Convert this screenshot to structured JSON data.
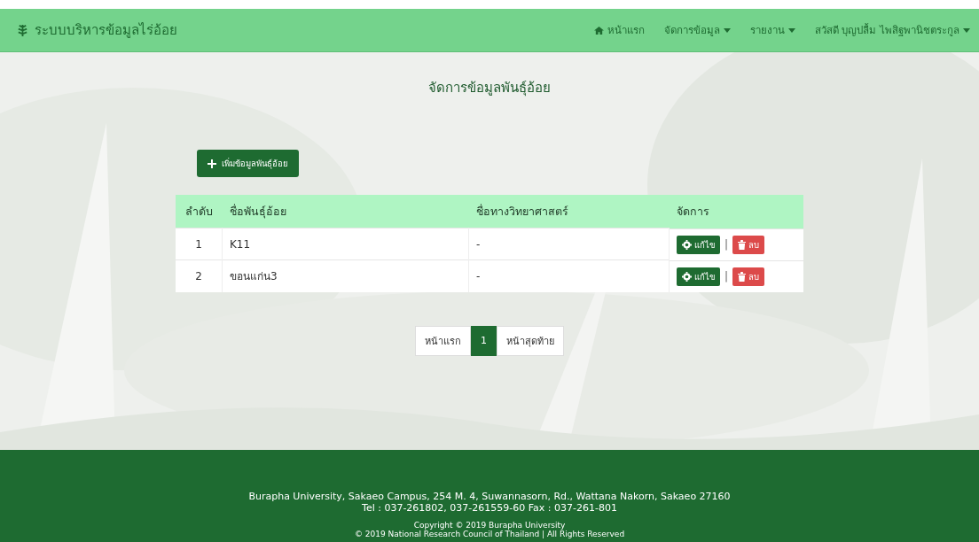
{
  "navbar": {
    "brand": "ระบบบริหารข้อมูลไร่อ้อย",
    "items": [
      {
        "label": "หน้าแรก",
        "kind": "home"
      },
      {
        "label": "จัดการข้อมูล",
        "kind": "dropdown"
      },
      {
        "label": "รายงาน",
        "kind": "dropdown"
      },
      {
        "label": "สวัสดี บุญปลื้ม ไพสิฐพานิชตระกูล",
        "kind": "dropdown"
      }
    ]
  },
  "page_title": "จัดการข้อมูลพันธุ์อ้อย",
  "add_button": "เพิ่มข้อมูลพันธุ์อ้อย",
  "table": {
    "columns": [
      "ลำดับ",
      "ชื่อพันธุ์อ้อย",
      "ชื่อทางวิทยาศาสตร์",
      "จัดการ"
    ],
    "rows": [
      {
        "index": "1",
        "name": "K11",
        "scientific_name": "-",
        "edit": "แก้ไข",
        "separator": "|",
        "delete": "ลบ"
      },
      {
        "index": "2",
        "name": "ขอนแก่น3",
        "scientific_name": "-",
        "edit": "แก้ไข",
        "separator": "|",
        "delete": "ลบ"
      }
    ]
  },
  "pagination": [
    {
      "label": "หน้าแรก",
      "selected": false
    },
    {
      "label": "1",
      "selected": true
    },
    {
      "label": "หน้าสุดท้าย",
      "selected": false
    }
  ],
  "footer": {
    "address": [
      "Burapha University, Sakaeo Campus, 254 M. 4, Suwannasorn, Rd., Wattana Nakorn, Sakaeo 27160",
      "Tel : 037-261802, 037-261559-60 Fax : 037-261-801"
    ],
    "copyright": [
      "Copyright © 2019 Burapha University",
      "© 2019 National Research Council of Thailand | All Rights Reserved"
    ]
  }
}
